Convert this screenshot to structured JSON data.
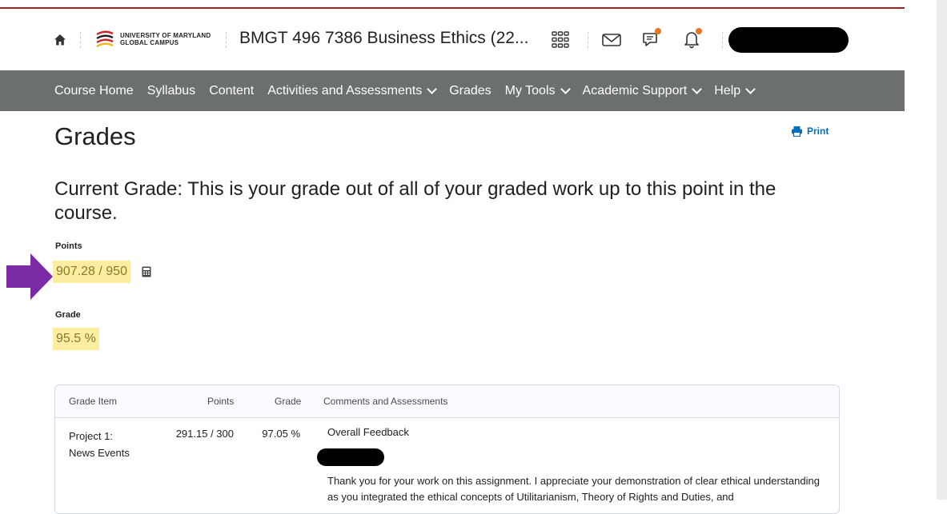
{
  "header": {
    "logo_line1": "UNIVERSITY OF MARYLAND",
    "logo_line2": "GLOBAL CAMPUS",
    "course_title": "BMGT 496 7386 Business Ethics (22...",
    "icons": [
      "home-icon",
      "apps-grid-icon",
      "mail-icon",
      "chat-icon",
      "bell-icon"
    ],
    "accent_color": "#a81f24",
    "badge_color": "#e87722"
  },
  "nav": {
    "items": [
      {
        "label": "Course Home",
        "dropdown": false
      },
      {
        "label": "Syllabus",
        "dropdown": false
      },
      {
        "label": "Content",
        "dropdown": false
      },
      {
        "label": "Activities and Assessments",
        "dropdown": true
      },
      {
        "label": "Grades",
        "dropdown": false
      },
      {
        "label": "My Tools",
        "dropdown": true
      },
      {
        "label": "Academic Support",
        "dropdown": true
      },
      {
        "label": "Help",
        "dropdown": true
      }
    ]
  },
  "page": {
    "title": "Grades",
    "print_label": "Print",
    "current_grade_heading": "Current Grade: This is your grade out of all of your graded work up to this point in the course.",
    "points_label": "Points",
    "points_value": "907.28 / 950",
    "grade_label": "Grade",
    "grade_value": "95.5 %"
  },
  "table": {
    "headers": [
      "Grade Item",
      "Points",
      "Grade",
      "Comments and Assessments"
    ],
    "rows": [
      {
        "item_line1": "Project 1:",
        "item_line2": "News Events",
        "points": "291.15 / 300",
        "grade": "97.05 %",
        "feedback_title": "Overall Feedback",
        "feedback_text": "Thank you for your work on this assignment. I appreciate your demonstration of clear ethical understanding as you integrated the ethical concepts of Utilitarianism, Theory of Rights and Duties, and"
      }
    ]
  }
}
